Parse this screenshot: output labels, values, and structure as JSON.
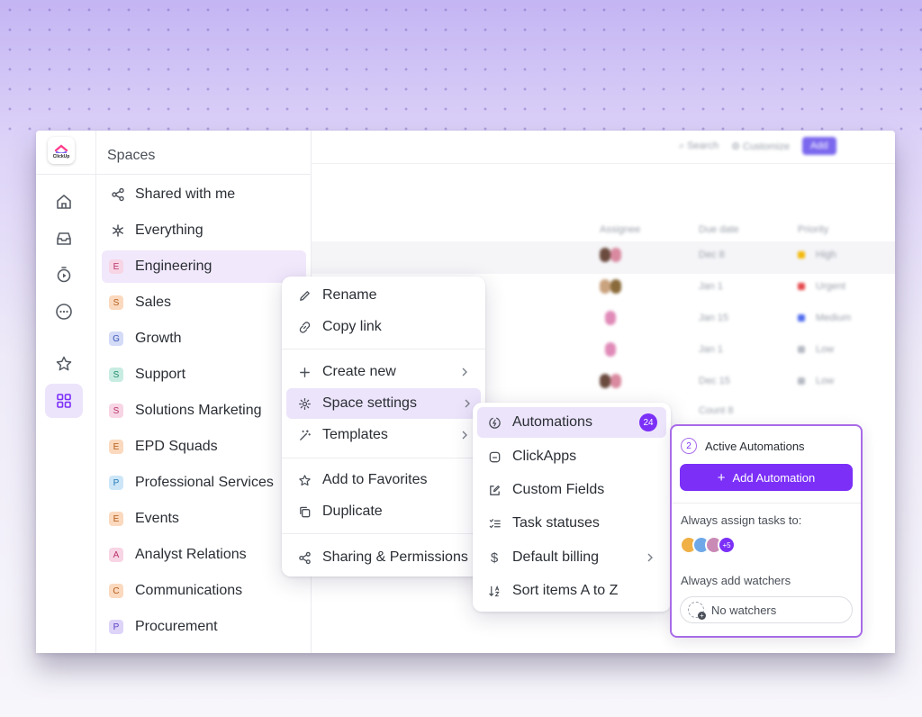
{
  "logo": {
    "text": "ClickUp"
  },
  "sidebar": {
    "title": "Spaces",
    "items": [
      {
        "label": "Shared with me",
        "icon": "share-icon"
      },
      {
        "label": "Everything",
        "icon": "asterisk-icon"
      },
      {
        "label": "Engineering",
        "badge": "E",
        "badge_color": "#f7d5e4",
        "badge_text_color": "#b8336a"
      },
      {
        "label": "Sales",
        "badge": "S",
        "badge_color": "#fbd9be",
        "badge_text_color": "#b25b18"
      },
      {
        "label": "Growth",
        "badge": "G",
        "badge_color": "#d4dbf7",
        "badge_text_color": "#3d56b8"
      },
      {
        "label": "Support",
        "badge": "S",
        "badge_color": "#c8ece2",
        "badge_text_color": "#1f8a6a"
      },
      {
        "label": "Solutions Marketing",
        "badge": "S",
        "badge_color": "#f7d5e4",
        "badge_text_color": "#b8336a"
      },
      {
        "label": "EPD Squads",
        "badge": "E",
        "badge_color": "#fbd9be",
        "badge_text_color": "#b25b18"
      },
      {
        "label": "Professional Services",
        "badge": "P",
        "badge_color": "#cce6f7",
        "badge_text_color": "#2378b8"
      },
      {
        "label": "Events",
        "badge": "E",
        "badge_color": "#fbd9be",
        "badge_text_color": "#b25b18"
      },
      {
        "label": "Analyst Relations",
        "badge": "A",
        "badge_color": "#f7d5e4",
        "badge_text_color": "#b8336a"
      },
      {
        "label": "Communications",
        "badge": "C",
        "badge_color": "#fbd9be",
        "badge_text_color": "#b25b18"
      },
      {
        "label": "Procurement",
        "badge": "P",
        "badge_color": "#ddd4f8",
        "badge_text_color": "#5b3fc4"
      }
    ]
  },
  "main": {
    "search_label": "Search",
    "customize_label": "Customize",
    "add_label": "Add",
    "columns": [
      "Assignee",
      "Due date",
      "Priority"
    ],
    "rows": [
      {
        "due": "Dec 8",
        "priority": "High",
        "flag": "#f2b705"
      },
      {
        "due": "Jan 1",
        "priority": "Urgent",
        "flag": "#e5484d"
      },
      {
        "due": "Jan 15",
        "priority": "Medium",
        "flag": "#4f6bed"
      },
      {
        "due": "Jan 1",
        "priority": "Low",
        "flag": "#b5b9c2"
      },
      {
        "due": "Dec 15",
        "priority": "Low",
        "flag": "#b5b9c2"
      }
    ],
    "count_label": "Count",
    "count_value": "8"
  },
  "context_menu": {
    "rename": "Rename",
    "copy_link": "Copy link",
    "create_new": "Create new",
    "space_settings": "Space settings",
    "templates": "Templates",
    "add_favorites": "Add to Favorites",
    "duplicate": "Duplicate",
    "sharing": "Sharing & Permissions"
  },
  "settings_menu": {
    "automations": "Automations",
    "automations_count": "24",
    "clickapps": "ClickApps",
    "custom_fields": "Custom Fields",
    "task_statuses": "Task statuses",
    "default_billing": "Default billing",
    "sort_items": "Sort items A to Z"
  },
  "automation_panel": {
    "count": "2",
    "title": "Active Automations",
    "add_button": "Add Automation",
    "assign_label": "Always assign tasks to:",
    "more_assignees": "+5",
    "watchers_label": "Always add watchers",
    "no_watchers": "No watchers"
  },
  "colors": {
    "accent": "#7b2ff7",
    "accent_light": "#ece4fb"
  }
}
